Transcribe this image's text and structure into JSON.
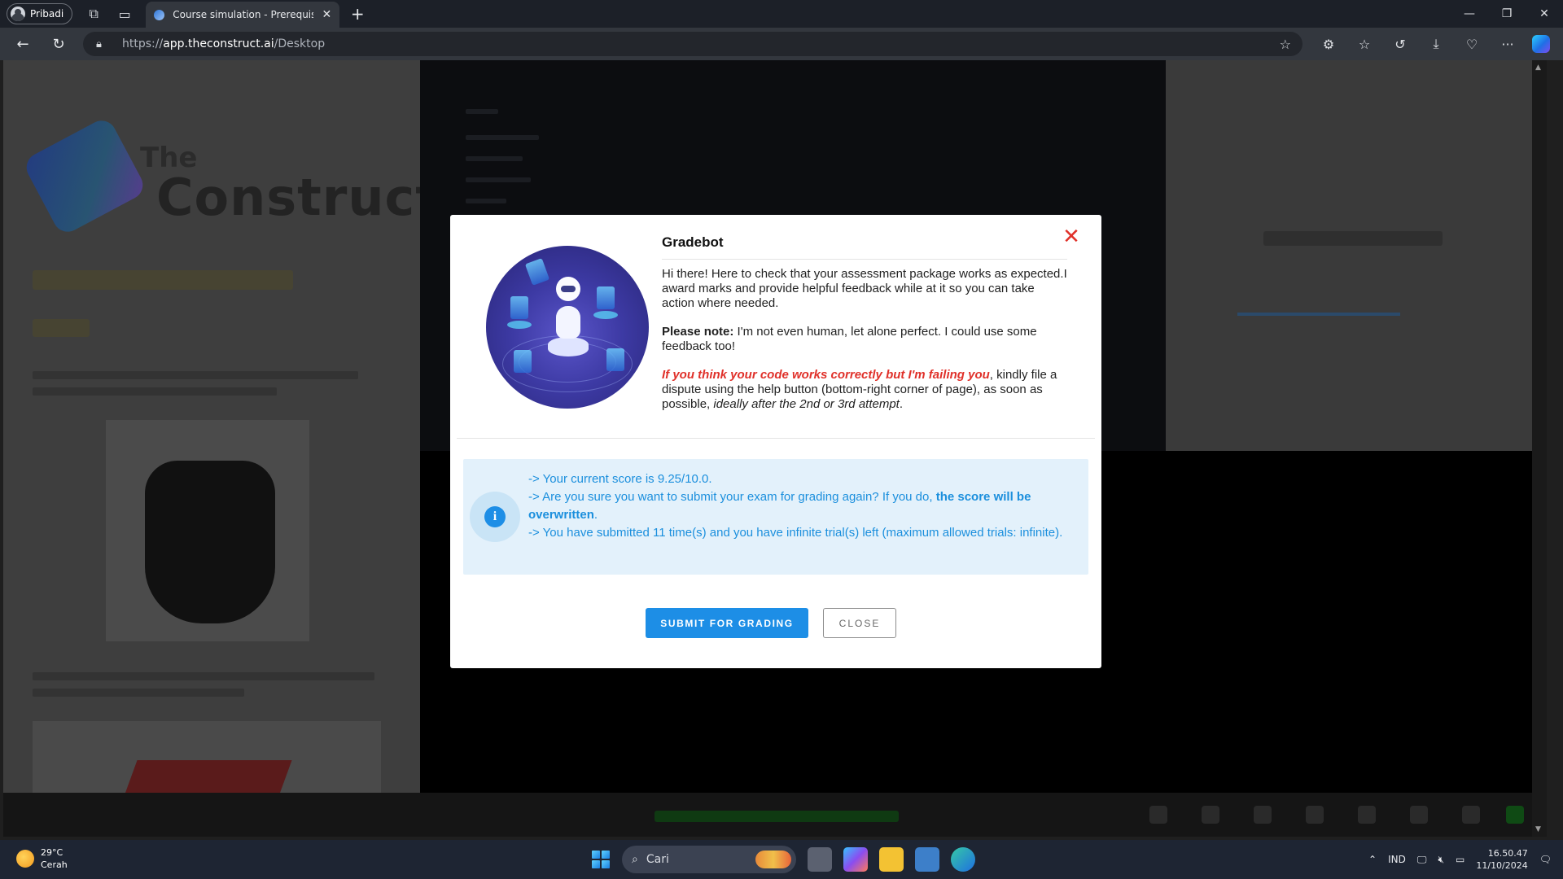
{
  "browser": {
    "profile_label": "Pribadi",
    "tab_title": "Course simulation - Prerequisites",
    "url_scheme": "https://",
    "url_host": "app.theconstruct.ai",
    "url_path": "/Desktop"
  },
  "background_page": {
    "logo_line1": "The",
    "logo_line2": "Construct"
  },
  "modal": {
    "title": "Gradebot",
    "intro": "Hi there! Here to check that your assessment package works as expected.I award marks and provide helpful feedback while at it so you can take action where needed.",
    "note_label": "Please note:",
    "note_text": " I'm not even human, let alone perfect. I could use some feedback too!",
    "dispute_warning": "If you think your code works correctly but I'm failing you",
    "dispute_text": ", kindly file a dispute using the help button (bottom-right corner of page), as soon as possible, ",
    "dispute_emph": "ideally after the 2nd or 3rd attempt",
    "dispute_end": ".",
    "info": {
      "line1": "-> Your current score is 9.25/10.0.",
      "line2_prefix": "->  Are you sure you want to submit your exam for grading again? If you do, ",
      "line2_bold": "the score will be overwritten",
      "line2_suffix": ".",
      "line3": "-> You have submitted 11 time(s) and you have infinite trial(s) left (maximum allowed trials: infinite)."
    },
    "submit_label": "SUBMIT FOR GRADING",
    "close_label": "CLOSE",
    "accent_color": "#1d8ee6",
    "warning_color": "#e0312a"
  },
  "taskbar": {
    "temperature": "29°C",
    "weather_text": "Cerah",
    "search_placeholder": "Cari",
    "language": "IND",
    "time": "16.50.47",
    "date": "11/10/2024"
  }
}
